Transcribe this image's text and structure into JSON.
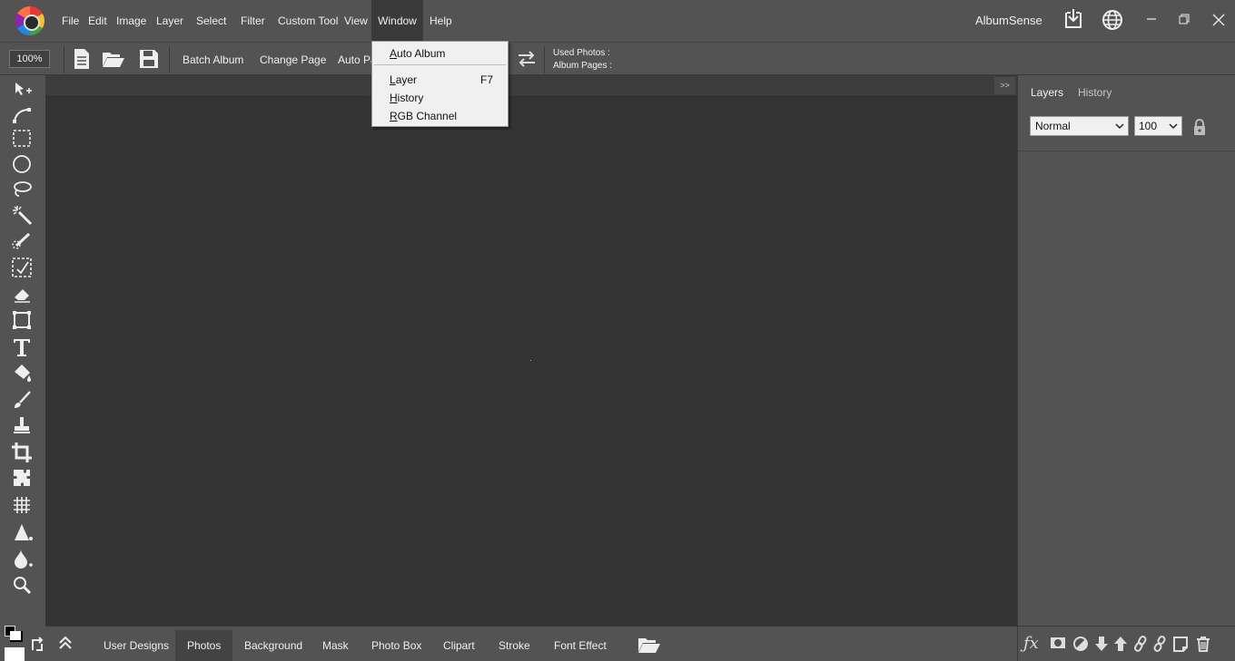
{
  "app": {
    "name": "AlbumSense"
  },
  "menu": {
    "file": "File",
    "edit": "Edit",
    "image": "Image",
    "layer": "Layer",
    "select": "Select",
    "filter": "Filter",
    "custom_tool": "Custom Tool",
    "view": "View",
    "window": "Window",
    "help": "Help"
  },
  "window_menu": {
    "auto_album_first": "A",
    "auto_album_rest": "uto Album",
    "layer_first": "L",
    "layer_rest": "ayer",
    "layer_shortcut": "F7",
    "history_first": "H",
    "history_rest": "istory",
    "rgb_first": "R",
    "rgb_rest": "GB Channel"
  },
  "toolbar": {
    "zoom": "100%",
    "batch_album": "Batch Album",
    "change_page": "Change Page",
    "auto_page": "Auto Pa",
    "used_photos": "Used Photos :",
    "album_pages": "Album Pages :"
  },
  "canvas_strip": {
    "collapse_label": ">>"
  },
  "right_panel": {
    "tab_layers": "Layers",
    "tab_history": "History",
    "blend_mode": "Normal",
    "opacity": "100"
  },
  "bottom_tabs": [
    "User Designs",
    "Photos",
    "Background",
    "Mask",
    "Photo Box",
    "Clipart",
    "Stroke",
    "Font Effect"
  ],
  "bottom_active_tab": "Photos",
  "icons": {
    "tools": [
      "move-icon",
      "pen-icon",
      "rect-marquee-icon",
      "ellipse-marquee-icon",
      "lasso-icon",
      "magic-wand-icon",
      "quick-select-icon",
      "selection-transform-icon",
      "eraser-icon",
      "transform-icon",
      "text-icon",
      "paint-bucket-icon",
      "brush-icon",
      "stamp-icon",
      "crop-icon",
      "puzzle-icon",
      "filter-icon",
      "sharpen-icon",
      "blur-drop-icon",
      "zoom-icon"
    ],
    "layer_actions": [
      "fx-icon",
      "mask-icon",
      "adjustment-icon",
      "move-down-icon",
      "move-up-icon",
      "link-icon",
      "unlink-icon",
      "new-layer-icon",
      "trash-icon"
    ]
  },
  "colors": {
    "menubar": "#535353",
    "canvas": "#333333",
    "dropdown_bg": "#f0f0f0"
  }
}
